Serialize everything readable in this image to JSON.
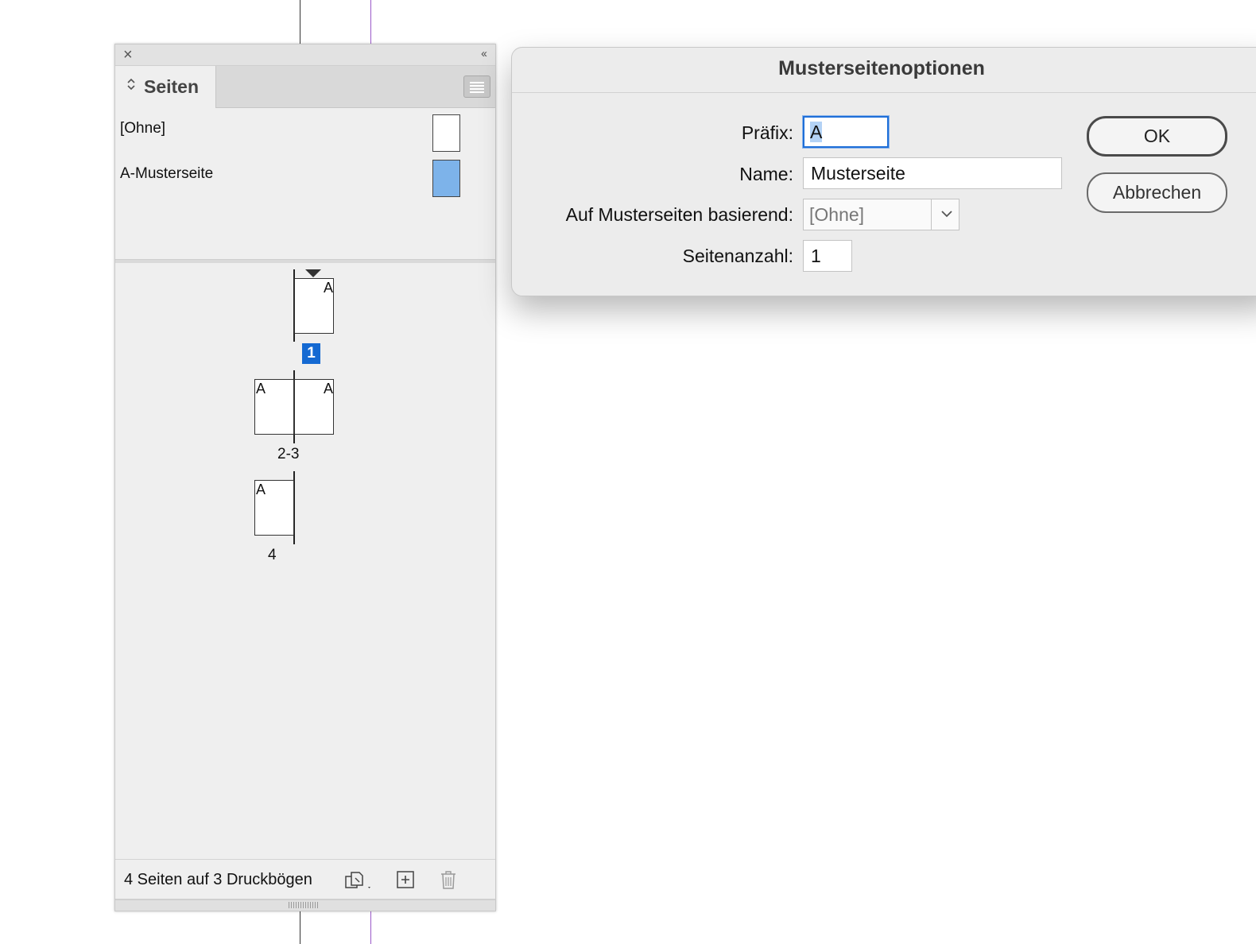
{
  "panel": {
    "tab_label": "Seiten",
    "masters": [
      {
        "label": "[Ohne]",
        "color": "#ffffff"
      },
      {
        "label": "A-Musterseite",
        "color": "#7db3ea"
      }
    ],
    "pages": {
      "p1_letter": "A",
      "p1_number": "1",
      "p2_letter": "A",
      "p3_letter": "A",
      "spread_23_label": "2-3",
      "p4_letter": "A",
      "p4_number": "4"
    },
    "footer_status": "4 Seiten auf 3 Druckbögen",
    "icons": [
      "close-icon",
      "collapse-icon",
      "panel-menu-icon",
      "edit-page-size-icon",
      "new-page-icon",
      "trash-icon"
    ]
  },
  "dialog": {
    "title": "Musterseitenoptionen",
    "prefix_label": "Präfix:",
    "prefix_value": "A",
    "name_label": "Name:",
    "name_value": "Musterseite",
    "based_on_label": "Auf Musterseiten basierend:",
    "based_on_value": "[Ohne]",
    "page_count_label": "Seitenanzahl:",
    "page_count_value": "1",
    "ok_label": "OK",
    "cancel_label": "Abbrechen"
  },
  "colors": {
    "selection_blue": "#1469d2",
    "focus_ring": "#1f6fd8",
    "master_a_color": "#7db3ea",
    "guide_purple": "#9b59c9"
  }
}
